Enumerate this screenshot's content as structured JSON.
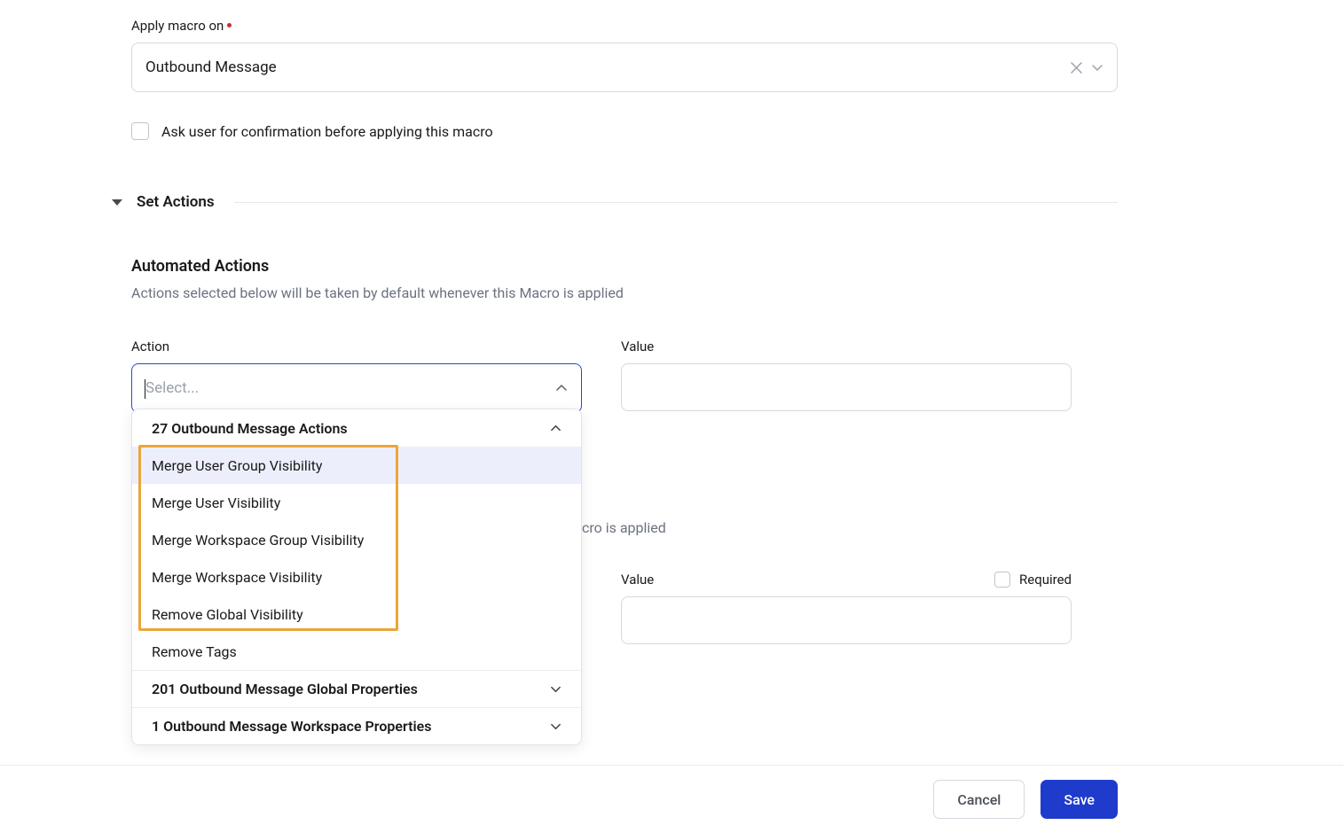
{
  "applyMacro": {
    "label": "Apply macro on",
    "value": "Outbound Message"
  },
  "confirmCheckbox": {
    "label": "Ask user for confirmation before applying this macro"
  },
  "setActions": {
    "heading": "Set Actions"
  },
  "automatedActions": {
    "title": "Automated Actions",
    "description": "Actions selected below will be taken by default whenever this Macro is applied"
  },
  "actionField": {
    "label": "Action",
    "placeholder": "Select..."
  },
  "valueField": {
    "label": "Value"
  },
  "dropdown": {
    "groupHeader": "27 Outbound Message Actions",
    "items": [
      "Merge User Group Visibility",
      "Merge User Visibility",
      "Merge Workspace Group Visibility",
      "Merge Workspace Visibility",
      "Remove Global Visibility",
      "Remove Tags"
    ],
    "group2": "201 Outbound Message Global Properties",
    "group3": "1 Outbound Message Workspace Properties"
  },
  "behindText": "cro is applied",
  "value2": {
    "label": "Value",
    "requiredLabel": "Required"
  },
  "footer": {
    "cancel": "Cancel",
    "save": "Save"
  }
}
